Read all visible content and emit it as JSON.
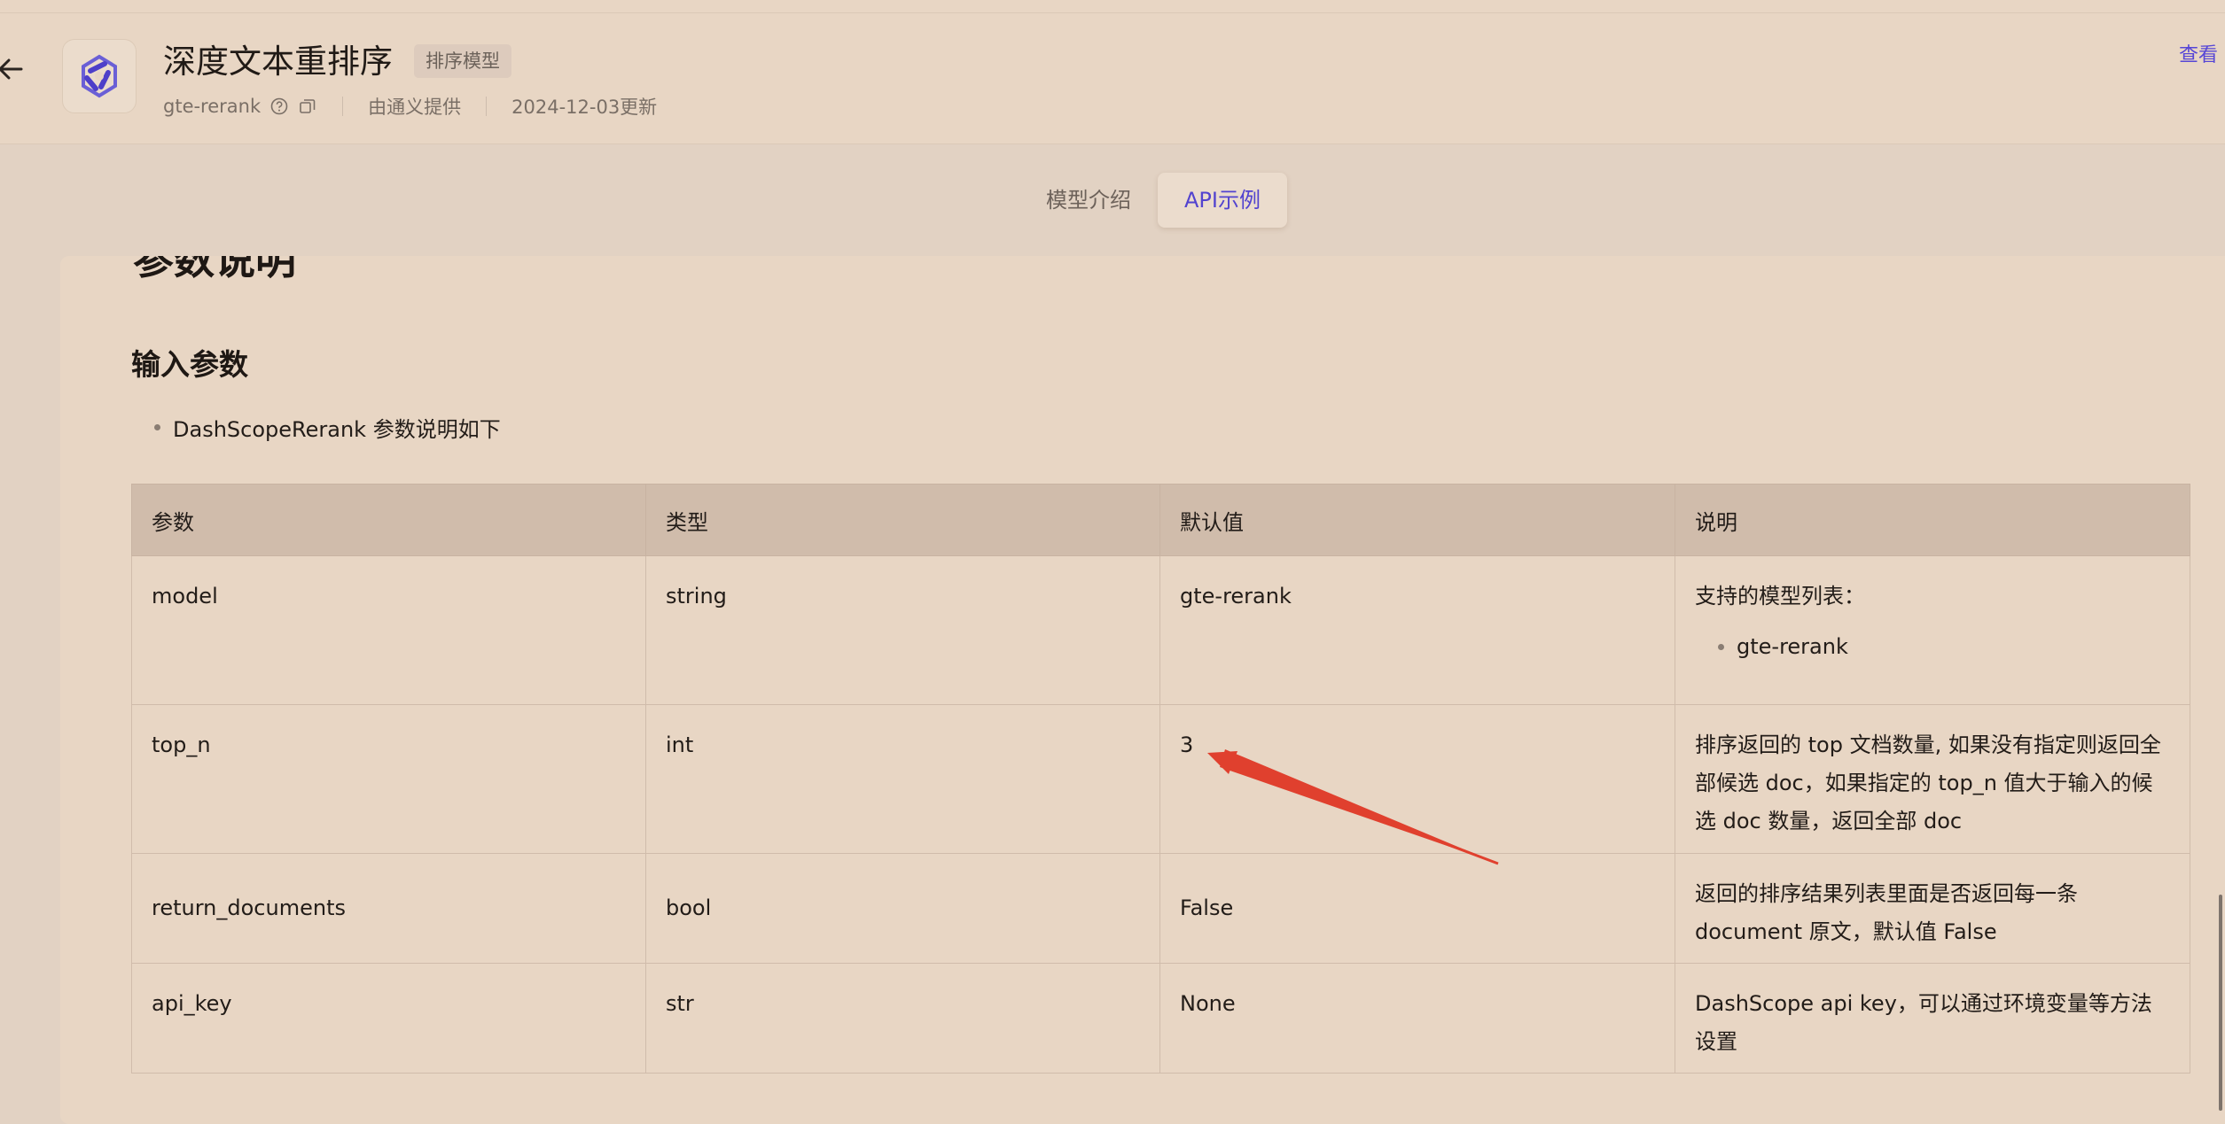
{
  "header": {
    "title": "深度文本重排序",
    "badge": "排序模型",
    "model_id": "gte-rerank",
    "provider": "由通义提供",
    "updated": "2024-12-03更新",
    "docs_link": "查看"
  },
  "tabs": [
    {
      "label": "模型介绍",
      "active": false
    },
    {
      "label": "API示例",
      "active": true
    }
  ],
  "content": {
    "cut_heading": "参数说明",
    "section_title": "输入参数",
    "bullet": "DashScopeRerank 参数说明如下",
    "table": {
      "headers": [
        "参数",
        "类型",
        "默认值",
        "说明"
      ],
      "rows": [
        {
          "param": "model",
          "type": "string",
          "default": "gte-rerank",
          "desc": "支持的模型列表：",
          "desc_item": "gte-rerank"
        },
        {
          "param": "top_n",
          "type": "int",
          "default": "3",
          "desc": "排序返回的 top 文档数量, 如果没有指定则返回全部候选 doc，如果指定的 top_n 值大于输入的候选 doc 数量，返回全部 doc"
        },
        {
          "param": "return_documents",
          "type": "bool",
          "default": "False",
          "desc": "返回的排序结果列表里面是否返回每一条 document 原文，默认值 False"
        },
        {
          "param": "api_key",
          "type": "str",
          "default": "None",
          "desc": "DashScope api key，可以通过环境变量等方法设置"
        }
      ]
    }
  },
  "icons": {
    "back": "arrow-left-icon",
    "logo": "qwen-logo-icon",
    "help": "question-circle-icon",
    "copy": "copy-icon"
  },
  "colors": {
    "accent": "#5243cf",
    "annotation": "#e0402e"
  }
}
